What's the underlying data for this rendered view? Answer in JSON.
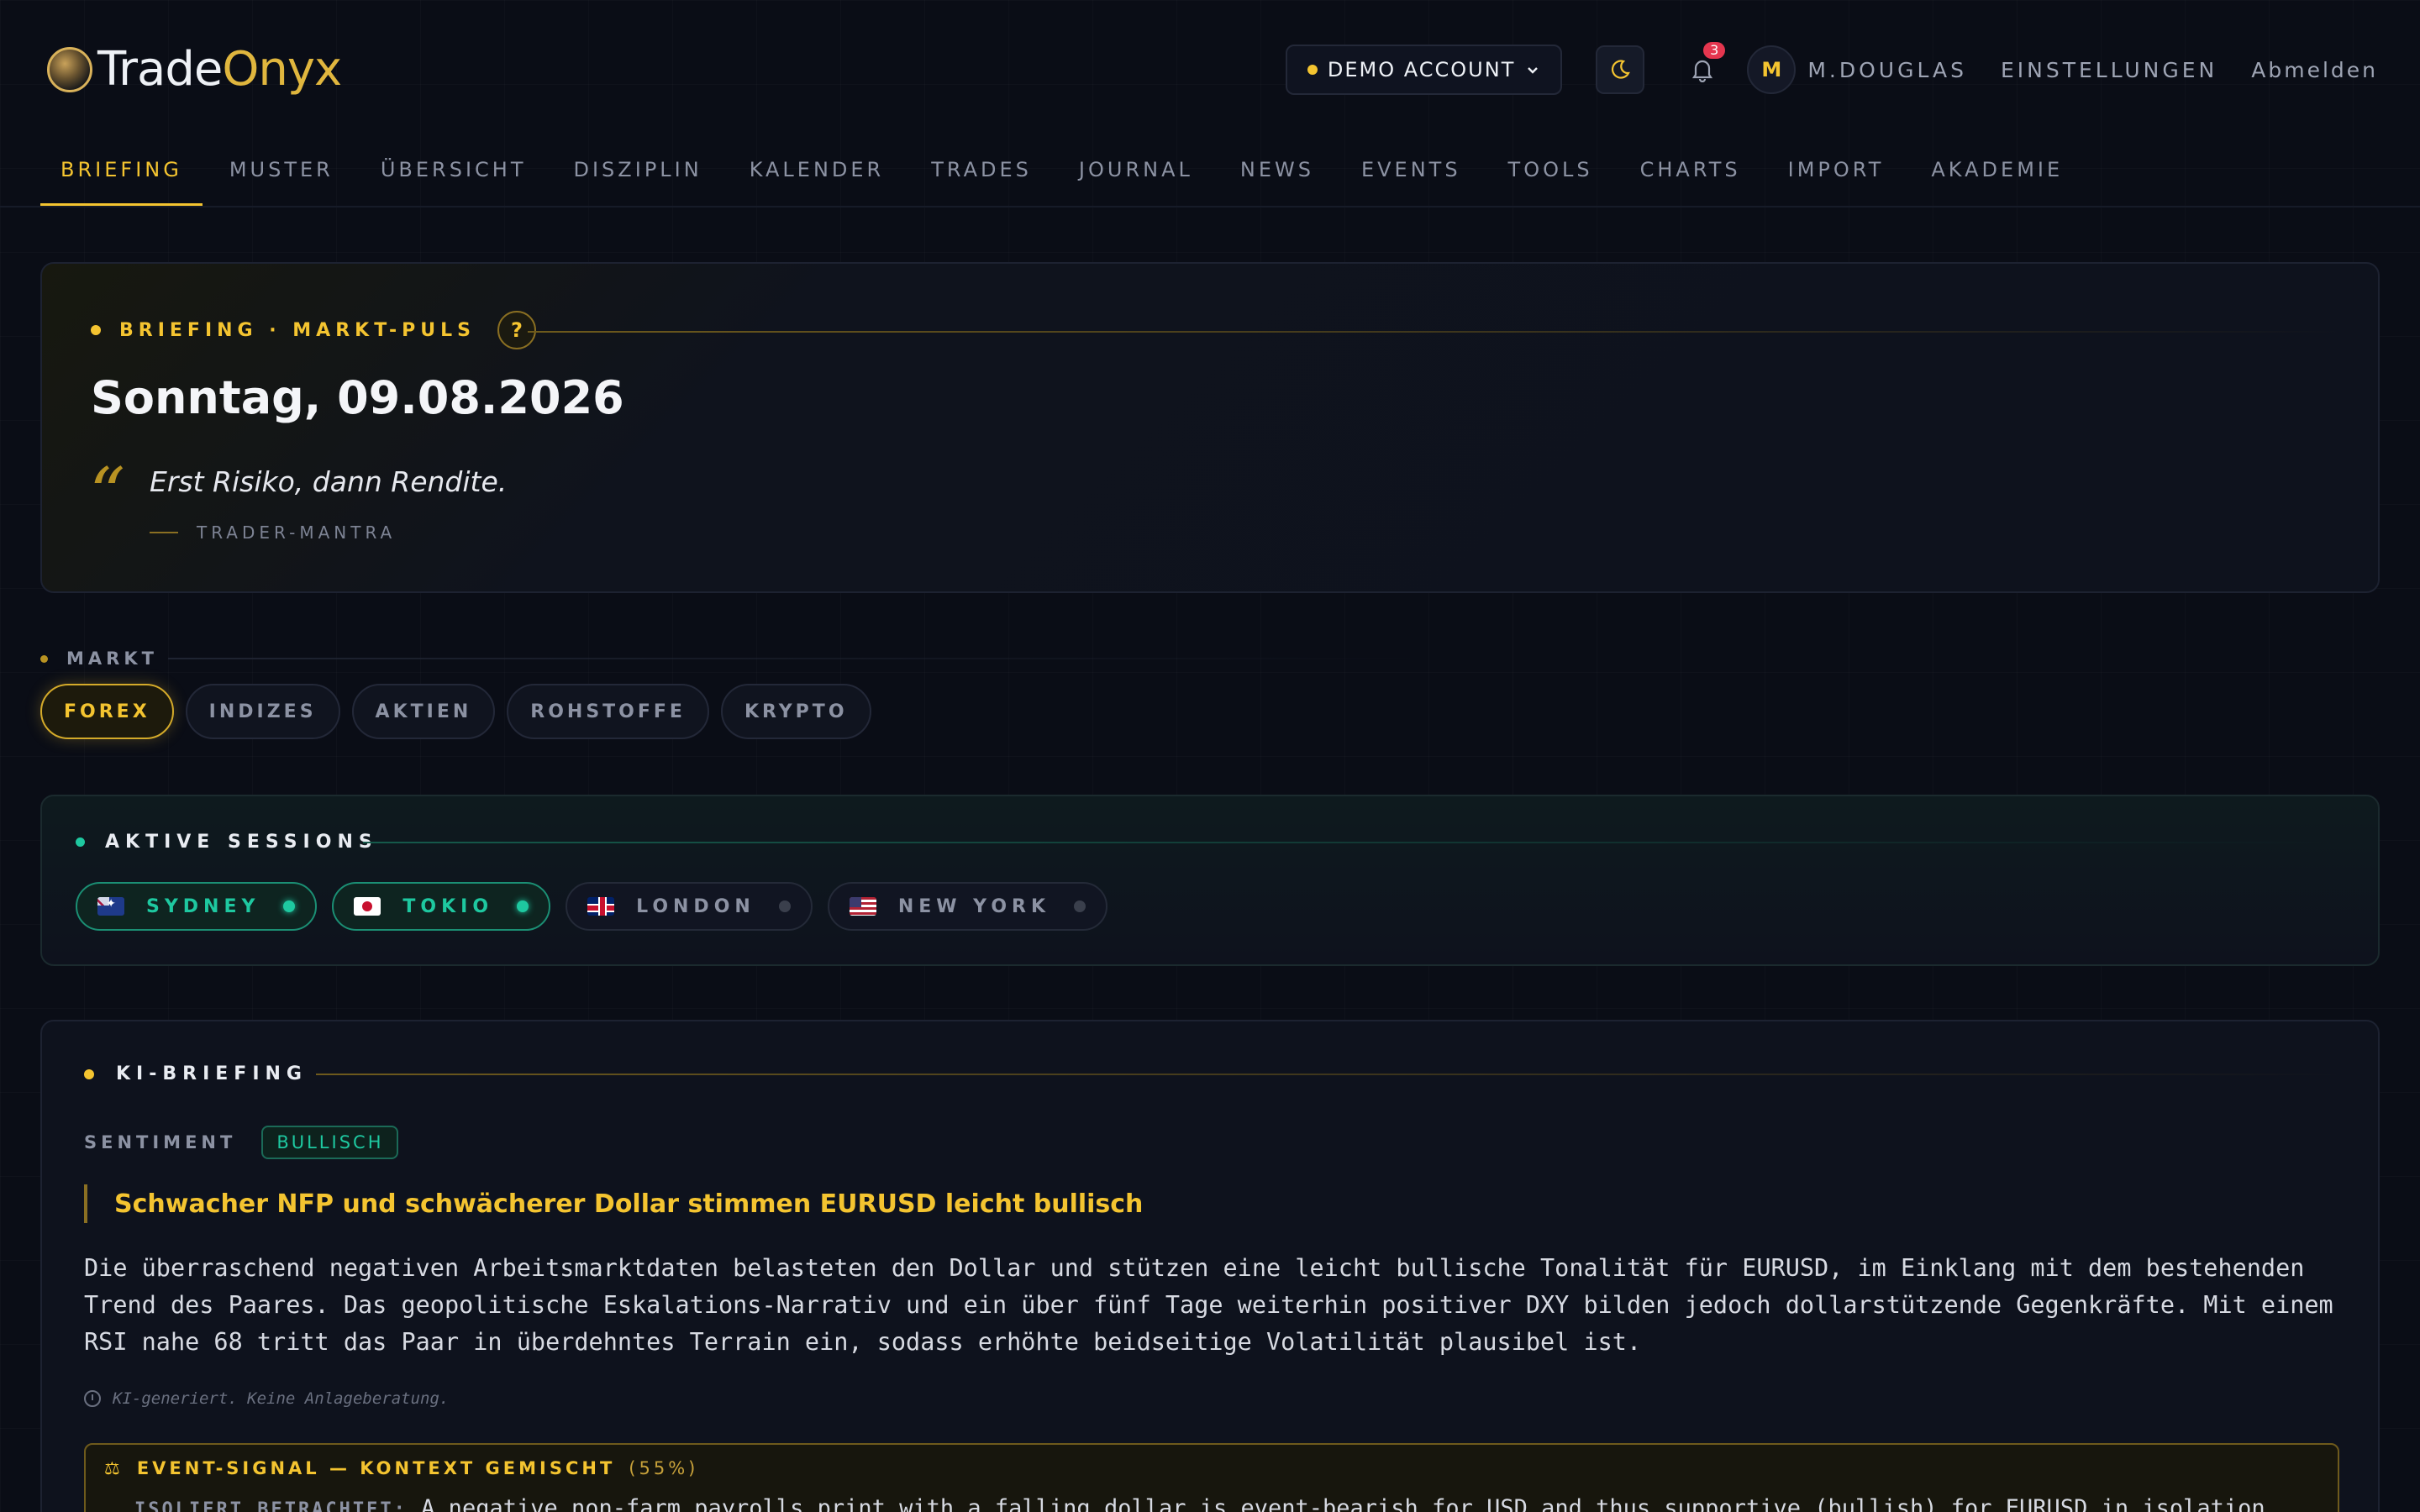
{
  "brand": {
    "part1": "Trade",
    "part2": "Onyx"
  },
  "header": {
    "account_label": "DEMO ACCOUNT",
    "notification_count": "3",
    "avatar_initial": "M",
    "username": "M.DOUGLAS",
    "settings_label": "EINSTELLUNGEN",
    "logout_label": "Abmelden"
  },
  "nav": {
    "items": [
      "BRIEFING",
      "MUSTER",
      "ÜBERSICHT",
      "DISZIPLIN",
      "KALENDER",
      "TRADES",
      "JOURNAL",
      "NEWS",
      "EVENTS",
      "TOOLS",
      "CHARTS",
      "IMPORT",
      "AKADEMIE"
    ],
    "active": "BRIEFING"
  },
  "briefing": {
    "eyebrow": "BRIEFING · MARKT-PULS",
    "help": "?",
    "date": "Sonntag, 09.08.2026",
    "quote_mark": "“",
    "quote": "Erst Risiko, dann Rendite.",
    "quote_source": "TRADER-MANTRA"
  },
  "market": {
    "label": "MARKT",
    "chips": [
      "FOREX",
      "INDIZES",
      "AKTIEN",
      "ROHSTOFFE",
      "KRYPTO"
    ],
    "active": "FOREX"
  },
  "sessions": {
    "title": "AKTIVE SESSIONS",
    "items": [
      {
        "name": "SYDNEY",
        "active": true
      },
      {
        "name": "TOKIO",
        "active": true
      },
      {
        "name": "LONDON",
        "active": false
      },
      {
        "name": "NEW YORK",
        "active": false
      }
    ]
  },
  "ai_briefing": {
    "title": "KI-BRIEFING",
    "sentiment_label": "SENTIMENT",
    "sentiment_value": "BULLISCH",
    "headline": "Schwacher NFP und schwächerer Dollar stimmen EURUSD leicht bullisch",
    "body": "Die überraschend negativen Arbeitsmarktdaten belasteten den Dollar und stützen eine leicht bullische Tonalität für EURUSD, im Einklang mit dem bestehenden Trend des Paares. Das geopolitische Eskalations-Narrativ und ein über fünf Tage weiterhin positiver DXY bilden jedoch dollarstützende Gegenkräfte. Mit einem RSI nahe 68 tritt das Paar in überdehntes Terrain ein, sodass erhöhte beidseitige Volatilität plausibel ist.",
    "disclaimer": "KI-generiert. Keine Anlageberatung.",
    "event_icon": "⚖",
    "event_title": "EVENT-SIGNAL — KONTEXT GEMISCHT",
    "event_pct": "(55%)",
    "event_key": "ISOLIERT BETRACHTET:",
    "event_text": "A negative non-farm payrolls print with a falling dollar is event-bearish for USD and thus supportive (bullish) for EURUSD in isolation."
  },
  "colors": {
    "accent": "#f4c430",
    "positive": "#1ec8a0",
    "background": "#0a0d16"
  }
}
